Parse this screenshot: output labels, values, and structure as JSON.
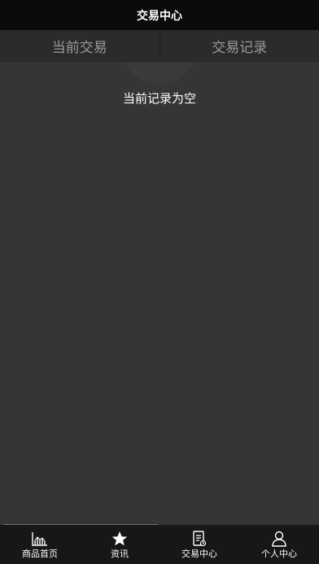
{
  "header": {
    "title": "交易中心"
  },
  "tabs": [
    {
      "label": "当前交易"
    },
    {
      "label": "交易记录"
    }
  ],
  "main": {
    "empty_text": "当前记录为空"
  },
  "tabbar": {
    "items": [
      {
        "label": "商品首页",
        "icon": "chart-icon"
      },
      {
        "label": "资讯",
        "icon": "star-icon"
      },
      {
        "label": "交易中心",
        "icon": "document-icon"
      },
      {
        "label": "个人中心",
        "icon": "user-icon"
      }
    ]
  },
  "colors": {
    "header_bg": "#0b0b0b",
    "tabs_bg": "#2b2b2b",
    "page_bg": "#353535",
    "tabbar_bg": "#171717",
    "tab_text": "#9a9a9a",
    "text": "#ffffff"
  }
}
